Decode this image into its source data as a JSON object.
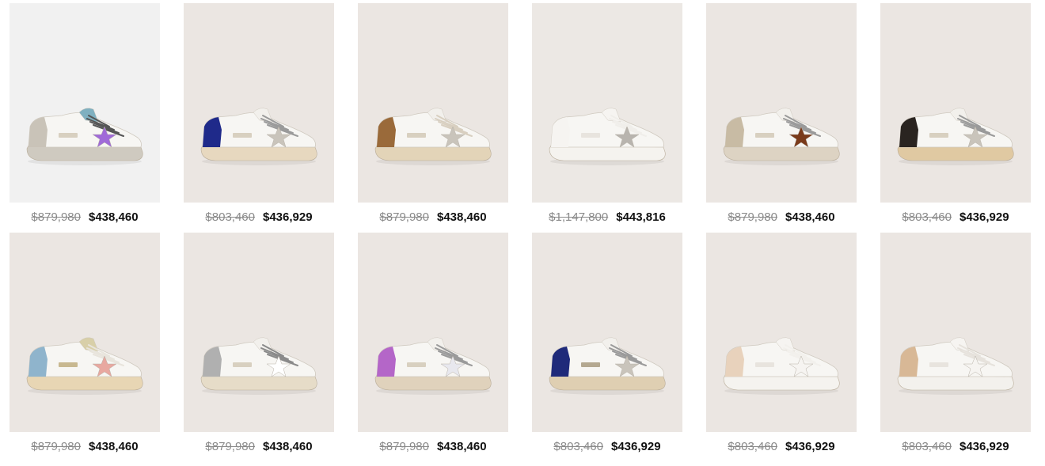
{
  "products": [
    {
      "original_price": "$879,980",
      "sale_price": "$438,460",
      "bg": "#f1f1f1",
      "heel": "#c9c3b8",
      "tongue": "#7fb0c0",
      "star": "#a06ad8",
      "laces": "#555555",
      "sole": "#cfcac0",
      "tab": "#d8d0c0"
    },
    {
      "original_price": "$803,460",
      "sale_price": "$436,929",
      "bg": "#ebe6e2",
      "heel": "#1f2a8a",
      "tongue": "#f2f0ec",
      "star": "#c9c4bb",
      "laces": "#9a9a9a",
      "sole": "#e7d8bf",
      "tab": "#d8d0c0"
    },
    {
      "original_price": "$879,980",
      "sale_price": "$438,460",
      "bg": "#ebe6e2",
      "heel": "#9a6a3a",
      "tongue": "#f2f0ec",
      "star": "#c9c4bb",
      "laces": "#d8cfc0",
      "sole": "#e3d4b8",
      "tab": "#d8d0c0"
    },
    {
      "original_price": "$1,147,800",
      "sale_price": "$443,816",
      "bg": "#ece8e4",
      "heel": "#f6f4f1",
      "tongue": "#f6f4f1",
      "star": "#b8b4ae",
      "laces": "#f0eeea",
      "sole": "#f5f3ef",
      "tab": "#e8e4de"
    },
    {
      "original_price": "$879,980",
      "sale_price": "$438,460",
      "bg": "#ebe6e2",
      "heel": "#c8bba4",
      "tongue": "#f2f0ec",
      "star": "#7a3a1a",
      "laces": "#9a9a9a",
      "sole": "#ddd3c3",
      "tab": "#d8d0c0"
    },
    {
      "original_price": "$803,460",
      "sale_price": "$436,929",
      "bg": "#ebe6e2",
      "heel": "#2a2420",
      "tongue": "#f2f0ec",
      "star": "#c9c4bb",
      "laces": "#9a9a9a",
      "sole": "#e0c9a2",
      "tab": "#d8d0c0"
    },
    {
      "original_price": "$879,980",
      "sale_price": "$438,460",
      "bg": "#ebe6e2",
      "heel": "#8fb4cc",
      "tongue": "#d8cfa8",
      "star": "#e8a8a0",
      "laces": "#e8e4dc",
      "sole": "#e8d6b4",
      "tab": "#c8b890"
    },
    {
      "original_price": "$879,980",
      "sale_price": "$438,460",
      "bg": "#ebe6e2",
      "heel": "#b0b0b0",
      "tongue": "#f2f0ec",
      "star": "#ffffff",
      "laces": "#8a8a8a",
      "sole": "#e6dcc8",
      "tab": "#d8d0c0"
    },
    {
      "original_price": "$879,980",
      "sale_price": "$438,460",
      "bg": "#ebe6e2",
      "heel": "#b466c8",
      "tongue": "#f2f0ec",
      "star": "#e8e8ee",
      "laces": "#9a9a9a",
      "sole": "#e0d2bc",
      "tab": "#d8d0c0"
    },
    {
      "original_price": "$803,460",
      "sale_price": "$436,929",
      "bg": "#ebe6e2",
      "heel": "#1f2a7a",
      "tongue": "#f2f0ec",
      "star": "#c9c4bb",
      "laces": "#9a9a9a",
      "sole": "#dfcfb2",
      "tab": "#b4a890"
    },
    {
      "original_price": "$803,460",
      "sale_price": "$436,929",
      "bg": "#ebe6e2",
      "heel": "#e8d2bc",
      "tongue": "#f6f4f1",
      "star": "#f6f4f1",
      "laces": "#f2f0ec",
      "sole": "#f5f3ef",
      "tab": "#e8e4de"
    },
    {
      "original_price": "$803,460",
      "sale_price": "$436,929",
      "bg": "#ebe6e2",
      "heel": "#d8b896",
      "tongue": "#f6f4f1",
      "star": "#f6f4f1",
      "laces": "#e6e2dc",
      "sole": "#f3f1ed",
      "tab": "#e8e4de"
    }
  ]
}
